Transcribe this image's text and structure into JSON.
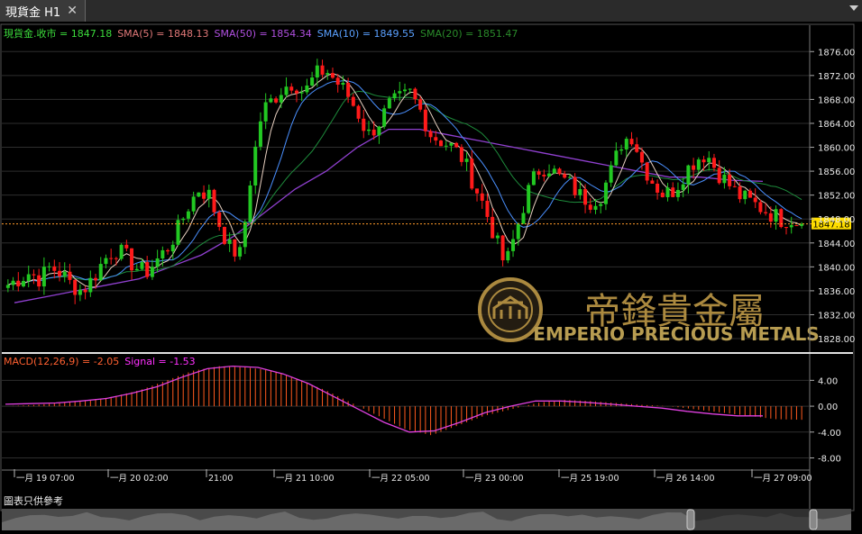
{
  "tab": {
    "title": "現貨金 H1",
    "close": "✕"
  },
  "legend": [
    {
      "text": "現貨金.收市 = 1847.18",
      "color": "#3cdc3c"
    },
    {
      "text": "SMA(5) = 1848.13",
      "color": "#e07878"
    },
    {
      "text": "SMA(50) = 1854.34",
      "color": "#b050e0"
    },
    {
      "text": "SMA(10) = 1849.55",
      "color": "#5aa0ff"
    },
    {
      "text": "SMA(20) = 1851.47",
      "color": "#2a8a2a"
    }
  ],
  "macd_legend": [
    {
      "text": "MACD(12,26,9) = -2.05",
      "color": "#ff6030"
    },
    {
      "text": "Signal = -1.53",
      "color": "#ff30ff"
    }
  ],
  "price_axis": [
    "1876.00",
    "1872.00",
    "1868.00",
    "1864.00",
    "1860.00",
    "1856.00",
    "1852.00",
    "1848.00",
    "1844.00",
    "1840.00",
    "1836.00",
    "1832.00",
    "1828.00"
  ],
  "macd_axis": [
    "4.00",
    "0.00",
    "-4.00",
    "-8.00"
  ],
  "current_price": "1847.18",
  "time_axis": [
    "一月 19 07:00",
    "一月 20 02:00",
    "21:00",
    "一月 21 10:00",
    "一月 22 05:00",
    "一月 23 00:00",
    "一月 25 19:00",
    "一月 26 14:00",
    "一月 27 09:00"
  ],
  "footer_note": "圖表只供參考",
  "watermark": {
    "chinese": "帝鋒貴金屬",
    "english": "EMPERIO PRECIOUS METALS"
  },
  "colors": {
    "up": "#22c822",
    "down": "#ff1a1a",
    "sma5": "#e8d0c0",
    "sma10": "#4a90ff",
    "sma20": "#1e8c3c",
    "sma50": "#9040d0",
    "macd_hist": "#ff5a1e",
    "signal": "#e040e0",
    "gold": "#c9a24a"
  },
  "chart_data": {
    "type": "candlestick",
    "symbol": "現貨金",
    "timeframe": "H1",
    "y_range": [
      1826.5,
      1878
    ],
    "macd_range": [
      -9.6,
      6
    ],
    "close_path": [
      1837,
      1838,
      1839,
      1838,
      1840,
      1839,
      1837,
      1836,
      1838,
      1841,
      1843,
      1842,
      1840,
      1839,
      1841,
      1843,
      1846,
      1850,
      1853,
      1852,
      1847,
      1843,
      1842,
      1856,
      1866,
      1868,
      1870,
      1871,
      1869,
      1872,
      1873,
      1871,
      1869,
      1866,
      1862,
      1864,
      1867,
      1868,
      1869,
      1866,
      1862,
      1861,
      1860,
      1858,
      1854,
      1850,
      1845,
      1840,
      1846,
      1852,
      1856,
      1857,
      1855,
      1854,
      1852,
      1851,
      1852,
      1856,
      1861,
      1862,
      1857,
      1854,
      1852,
      1853,
      1856,
      1858,
      1859,
      1856,
      1854,
      1852,
      1851,
      1850,
      1849,
      1848,
      1848,
      1847
    ],
    "sma50_path": [
      1834,
      1835,
      1836,
      1837,
      1838,
      1840,
      1842,
      1845,
      1849,
      1853,
      1856,
      1860,
      1863,
      1863,
      1862,
      1861,
      1860,
      1859,
      1858,
      1857,
      1856,
      1855,
      1855,
      1854.5,
      1854.3
    ],
    "macd_hist_path": [
      0,
      0.2,
      0.5,
      0.8,
      1.5,
      2.5,
      4,
      5.5,
      6.2,
      6,
      5.5,
      4,
      2.5,
      0.5,
      -1.5,
      -3.5,
      -4.5,
      -3,
      -1.5,
      -0.5,
      0.5,
      1,
      0.8,
      0.5,
      0.2,
      0,
      -0.5,
      -1,
      -1.5,
      -2,
      -2.1
    ],
    "signal_path": [
      0.3,
      0.4,
      0.5,
      0.8,
      1.2,
      2,
      3,
      4.5,
      5.8,
      6.2,
      6,
      5,
      3.5,
      1.5,
      -0.5,
      -2.5,
      -4,
      -3.8,
      -2.5,
      -1,
      0,
      0.8,
      0.8,
      0.6,
      0.3,
      0,
      -0.3,
      -0.8,
      -1.2,
      -1.5,
      -1.5
    ]
  }
}
